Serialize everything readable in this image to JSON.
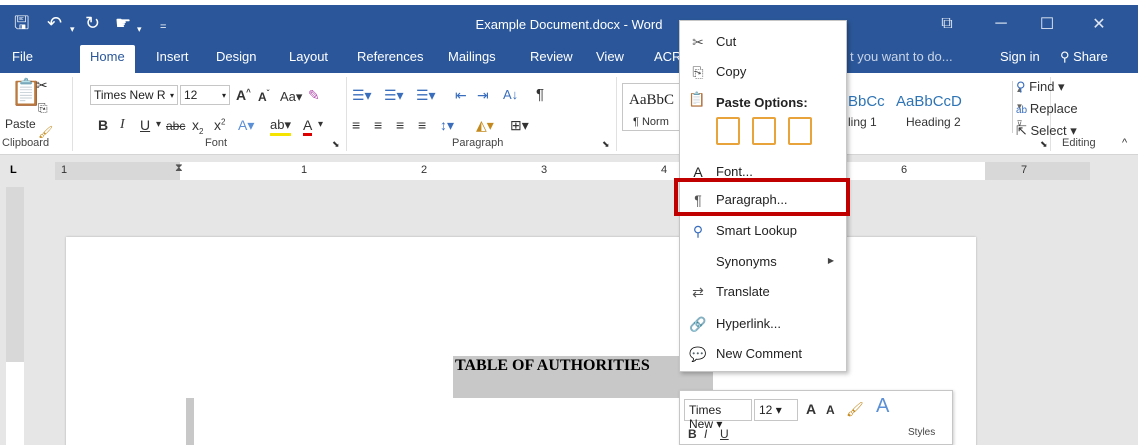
{
  "window": {
    "title": "Example Document.docx - Word",
    "sign_in": "Sign in",
    "share": "Share",
    "tell_me": "t you want to do..."
  },
  "tabs": [
    "File",
    "Home",
    "Insert",
    "Design",
    "Layout",
    "References",
    "Mailings",
    "Review",
    "View",
    "ACR"
  ],
  "ribbon": {
    "clipboard": {
      "paste": "Paste",
      "label": "Clipboard"
    },
    "font": {
      "name": "Times New R",
      "size": "12",
      "label": "Font"
    },
    "paragraph": {
      "label": "Paragraph"
    },
    "styles": {
      "normal_preview": "AaBbC",
      "normal_name": "¶ Norm",
      "h1_preview": "BbCc",
      "h1_name": "ling 1",
      "h2_preview": "AaBbCcD",
      "h2_name": "Heading 2"
    },
    "editing": {
      "find": "Find",
      "replace": "Replace",
      "select": "Select",
      "label": "Editing"
    }
  },
  "ruler": {
    "numbers": [
      "1",
      "1",
      "2",
      "3",
      "4",
      "6",
      "7"
    ]
  },
  "document": {
    "heading": "TABLE OF AUTHORITIES"
  },
  "context_menu": {
    "items": [
      {
        "label": "Cut",
        "icon": "scissors-icon"
      },
      {
        "label": "Copy",
        "icon": "copy-icon"
      },
      {
        "label": "Paste Options:",
        "icon": "paste-icon"
      },
      {
        "label": "Font...",
        "icon": "font-icon"
      },
      {
        "label": "Paragraph...",
        "icon": "paragraph-icon"
      },
      {
        "label": "Smart Lookup",
        "icon": "smart-lookup-icon"
      },
      {
        "label": "Synonyms",
        "icon": "none"
      },
      {
        "label": "Translate",
        "icon": "translate-icon"
      },
      {
        "label": "Hyperlink...",
        "icon": "hyperlink-icon"
      },
      {
        "label": "New Comment",
        "icon": "comment-icon"
      }
    ]
  },
  "mini_toolbar": {
    "font": "Times New",
    "size": "12",
    "styles": "Styles"
  },
  "colors": {
    "word_blue": "#2b579a",
    "highlight_red": "#c00000"
  }
}
